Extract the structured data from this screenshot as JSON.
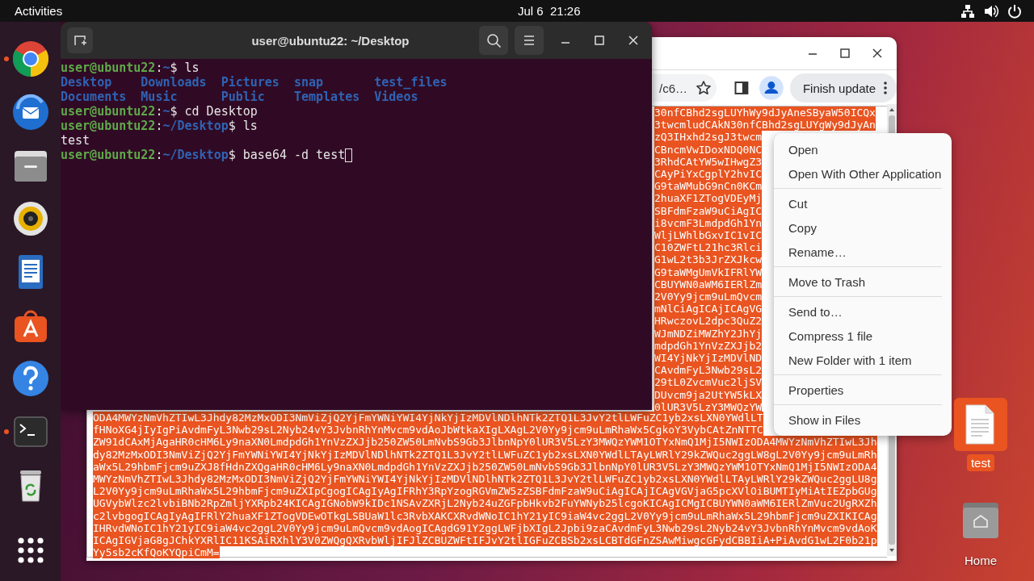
{
  "top_bar": {
    "activities": "Activities",
    "clock": "Jul 6  21:26"
  },
  "dock": [
    {
      "kind": "browser",
      "running": true
    },
    {
      "kind": "mail",
      "running": false
    },
    {
      "kind": "files",
      "running": false
    },
    {
      "kind": "music",
      "running": false
    },
    {
      "kind": "writer",
      "running": false
    },
    {
      "kind": "store",
      "running": false
    },
    {
      "kind": "help",
      "running": false
    },
    {
      "kind": "terminal",
      "running": true
    },
    {
      "kind": "trash",
      "running": false
    },
    {
      "kind": "apps",
      "running": false
    }
  ],
  "terminal": {
    "title": "user@ubuntu22: ~/Desktop",
    "lines": [
      {
        "kind": "prompt",
        "segments": [
          {
            "kind": "user",
            "text": "user@ubuntu22"
          },
          {
            "kind": "plain",
            "text": ":"
          },
          {
            "kind": "path",
            "text": "~"
          },
          {
            "kind": "plain",
            "text": "$ ls"
          }
        ]
      },
      {
        "kind": "listing",
        "segments": [
          {
            "kind": "dir",
            "text": "Desktop"
          },
          {
            "kind": "dir",
            "text": "Downloads"
          },
          {
            "kind": "dir",
            "text": "Pictures"
          },
          {
            "kind": "dir",
            "text": "snap"
          },
          {
            "kind": "dir",
            "text": "test_files"
          }
        ]
      },
      {
        "kind": "listing",
        "segments": [
          {
            "kind": "dir",
            "text": "Documents"
          },
          {
            "kind": "dir",
            "text": "Music"
          },
          {
            "kind": "dir",
            "text": "Public"
          },
          {
            "kind": "dir",
            "text": "Templates"
          },
          {
            "kind": "dir",
            "text": "Videos"
          }
        ]
      },
      {
        "kind": "prompt",
        "segments": [
          {
            "kind": "user",
            "text": "user@ubuntu22"
          },
          {
            "kind": "plain",
            "text": ":"
          },
          {
            "kind": "path",
            "text": "~"
          },
          {
            "kind": "plain",
            "text": "$ cd Desktop"
          }
        ]
      },
      {
        "kind": "prompt",
        "segments": [
          {
            "kind": "user",
            "text": "user@ubuntu22"
          },
          {
            "kind": "plain",
            "text": ":"
          },
          {
            "kind": "path",
            "text": "~/Desktop"
          },
          {
            "kind": "plain",
            "text": "$ ls"
          }
        ]
      },
      {
        "kind": "output",
        "segments": [
          {
            "kind": "plain",
            "text": "test"
          }
        ]
      },
      {
        "kind": "prompt",
        "cursor": true,
        "segments": [
          {
            "kind": "user",
            "text": "user@ubuntu22"
          },
          {
            "kind": "plain",
            "text": ":"
          },
          {
            "kind": "path",
            "text": "~/Desktop"
          },
          {
            "kind": "plain",
            "text": "$ base64 -d test"
          }
        ]
      }
    ]
  },
  "browser": {
    "address": "/c6…",
    "update_button": "Finish update",
    "text_selected": true,
    "upper_lines": [
      "30nfCBhd2sgLUYhWy9dJyAneSByaW50ICQx",
      "3twcmludCAkN30nfCBhd2sgLUYgWy9dJyAn",
      "zQ3IHxhd2sgJ3twcm",
      "CBncmVwIDoxNDQ0NC",
      "3RhdCAtYW5wIHwgZ3",
      "CAyPiYxCgplY2hvIC",
      "G9taWMubG9nCn0KCm",
      "2huaXF1ZTogVDEyMj",
      "SBFdmFzaW9uCiAgIC",
      "i8vcmF3LmdpdGh1Yn",
      "WljLWhlbGxvIC1vIC",
      "C10ZWFtL21hc3Rlci",
      "G1wL2t3b3JrZXJkcw",
      "G9taWMgUmVkIFRlYW",
      "CBUYWN0aWM6IERlZm",
      "2V0Yy9jcm9uLmQvcm",
      "mNlCiAgICAjICAgVG",
      "HRwczovL2dpc3QuZ2",
      "WJmNDZiMWZhY2JhYj",
      "mdpdGh1YnVzZXJjb2",
      "WI4YjNkYjIzMDVlND",
      "CAvdmFyL3Nwb29sL2",
      "29tL0ZvcmVuc2ljSV",
      "DUvcm9ja2UtYW5kLX",
      "0lUR3V5LzY3MWQzYW"
    ],
    "lower_lines": [
      "ODA4MWYzNmVhZTIwL3Jhdy82MzMxODI3NmViZjQ2YjFmYWNiYWI4YjNkYjIzMDVlNDlhNTk2ZTQ1L3JvY2tlLWFuZC1yb2xsLXN0YWdlLT",
      "fHNoXG4jIyIgPiAvdmFyL3Nwb29sL2Nyb24vY3JvbnRhYnMvcm9vdAoJbWtkaXIgLXAgL2V0Yy9jcm9uLmRhaWx5CgkoY3VybCAtZnNTTC",
      "ZW91dCAxMjAgaHR0cHM6Ly9naXN0LmdpdGh1YnVzZXJjb250ZW50LmNvbS9Gb3JlbnNpY0lUR3V5LzY3MWQzYWM1OTYxNmQ1MjI5NWIzODA4MWYzNmVhZTIwL3Jh",
      "dy82MzMxODI3NmViZjQ2YjFmYWNiYWI4YjNkYjIzMDVlNDlhNTk2ZTQ1L3JvY2tlLWFuZC1yb2xsLXN0YWdlLTAyLWRlY29kZWQuc2ggLW8gL2V0Yy9jcm9uLmRh",
      "aWx5L29hbmFjcm9uZXJ8fHdnZXQgaHR0cHM6Ly9naXN0LmdpdGh1YnVzZXJjb250ZW50LmNvbS9Gb3JlbnNpY0lUR3V5LzY3MWQzYWM1OTYxNmQ1MjI5NWIzODA4",
      "MWYzNmVhZTIwL3Jhdy82MzMxODI3NmViZjQ2YjFmYWNiYWI4YjNkYjIzMDVlNDlhNTk2ZTQ1L3JvY2tlLWFuZC1yb2xsLXN0YWdlLTAyLWRlY29kZWQuc2ggLU8g",
      "L2V0Yy9jcm9uLmRhaWx5L29hbmFjcm9uZXIpCgogICAgIyAgIFRhY3RpYzogRGVmZW5zZSBFdmFzaW9uCiAgICAjICAgVGVjaG5pcXVlOiBUMTIyMiAtIEZpbGUg",
      "UGVybWlzc2lvbiBNb2RpZmljYXRpb24KICAgIGNobW9kIDc1NSAvZXRjL2Nyb24uZGFpbHkvb2FuYWNyb25lcgoKICAgICMgICBUYWN0aWM6IERlZmVuc2UgRXZh",
      "c2lvbgogICAgIyAgIFRlY2huaXF1ZTogVDEwOTkgLSBUaW1lc3RvbXAKCXRvdWNoIC1hY21yIC9iaW4vc2ggL2V0Yy9jcm9uLmRhaWx5L29hbmFjcm9uZXIKICAg",
      "IHRvdWNoIC1hY21yIC9iaW4vc2ggL2V0Yy9jcm9uLmQvcm9vdAogICAgdG91Y2ggLWFjbXIgL2Jpbi9zaCAvdmFyL3Nwb29sL2Nyb24vY3JvbnRhYnMvcm9vdAoK",
      "ICAgIGVjaG8gJChkYXRlIC11KSAiRXhlY3V0ZWQgQXRvbWljIFJlZCBUZWFtIFJvY2tlIGFuZCBSb2xsLCBTdGFnZSAwMiwgcGFydCBBIiA+PiAvdG1wL2F0b21p",
      "Yy5sb2cKfQoKYQpiCmM="
    ]
  },
  "context_menu": {
    "groups": [
      [
        "Open",
        "Open With Other Application"
      ],
      [
        "Cut",
        "Copy",
        "Rename…"
      ],
      [
        "Move to Trash"
      ],
      [
        "Send to…",
        "Compress 1 file",
        "New Folder with 1 item"
      ],
      [
        "Properties"
      ],
      [
        "Show in Files"
      ]
    ]
  },
  "desktop_icons": [
    {
      "kind": "file",
      "label": "test",
      "selected": true
    },
    {
      "kind": "folder",
      "label": "Home",
      "selected": false
    }
  ]
}
